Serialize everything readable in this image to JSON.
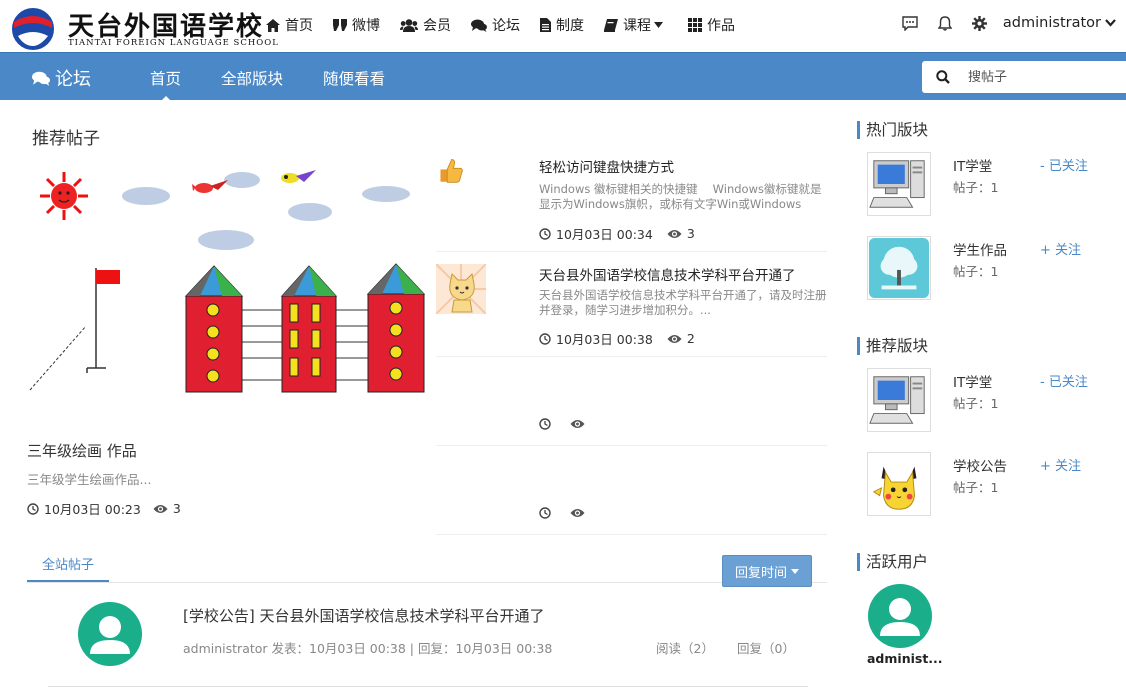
{
  "header": {
    "logo_title": "天台外国语学校",
    "logo_subtitle": "TIANTAI FOREIGN LANGUAGE SCHOOL",
    "nav": [
      {
        "label": "首页",
        "icon": "home-icon"
      },
      {
        "label": "微博",
        "icon": "quote-icon"
      },
      {
        "label": "会员",
        "icon": "users-icon"
      },
      {
        "label": "论坛",
        "icon": "comments-icon"
      },
      {
        "label": "制度",
        "icon": "file-icon"
      },
      {
        "label": "课程",
        "icon": "book-icon"
      },
      {
        "label": "作品",
        "icon": "grid-icon"
      }
    ],
    "username": "administrator"
  },
  "subbar": {
    "brand": "论坛",
    "tabs": [
      "首页",
      "全部版块",
      "随便看看"
    ],
    "active_tab": 0,
    "search_placeholder": "搜帖子"
  },
  "recommended": {
    "heading": "推荐帖子",
    "featured": {
      "title": "三年级绘画 作品",
      "desc": "三年级学生绘画作品...",
      "time": "10月03日 00:23",
      "views": "3"
    },
    "posts": [
      {
        "title": "轻松访问键盘快捷方式",
        "desc": "Windows 徽标键相关的快捷键　 Windows徽标键就是显示为Windows旗帜，或标有文字Win或Windows",
        "time": "10月03日 00:34",
        "views": "3"
      },
      {
        "title": "天台县外国语学校信息技术学科平台开通了",
        "desc": "天台县外国语学校信息技术学科平台开通了，请及时注册并登录，随学习进步增加积分。...",
        "time": "10月03日 00:38",
        "views": "2"
      },
      {
        "title": "",
        "desc": "",
        "time": "",
        "views": ""
      },
      {
        "title": "",
        "desc": "",
        "time": "",
        "views": ""
      }
    ]
  },
  "all_posts": {
    "tab_label": "全站帖子",
    "sort_label": "回复时间",
    "threads": [
      {
        "title": "[学校公告] 天台县外国语学校信息技术学科平台开通了",
        "meta": "administrator 发表：10月03日 00:38 | 回复：10月03日 00:38",
        "reads": "阅读（2）",
        "replies": "回复（0）"
      }
    ]
  },
  "sidebar": {
    "hot_heading": "热门版块",
    "hot_boards": [
      {
        "name": "IT学堂",
        "count": "帖子：1",
        "follow": "- 已关注",
        "thumb": "computer"
      },
      {
        "name": "学生作品",
        "count": "帖子：1",
        "follow": "+ 关注",
        "thumb": "tree"
      }
    ],
    "rec_heading": "推荐版块",
    "rec_boards": [
      {
        "name": "IT学堂",
        "count": "帖子：1",
        "follow": "- 已关注",
        "thumb": "computer"
      },
      {
        "name": "学校公告",
        "count": "帖子：1",
        "follow": "+ 关注",
        "thumb": "pikachu"
      }
    ],
    "active_heading": "活跃用户",
    "active_users": [
      {
        "name": "administ..."
      }
    ]
  },
  "colors": {
    "primary": "#4a88c8",
    "avatar": "#1aae8a"
  }
}
